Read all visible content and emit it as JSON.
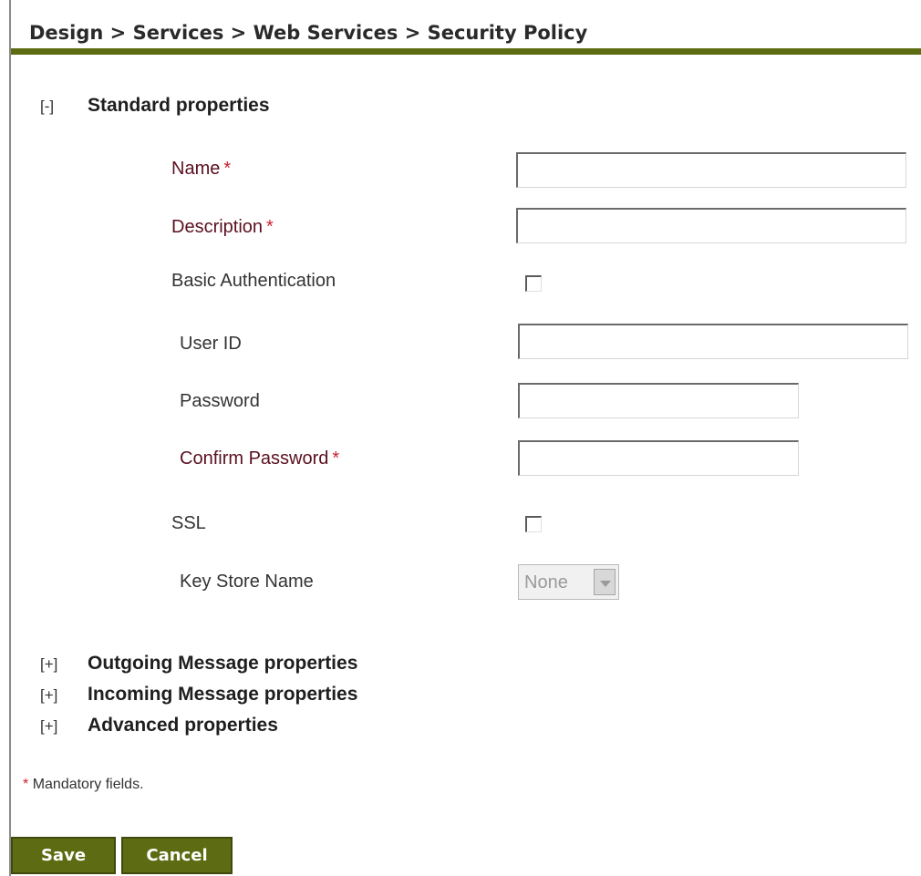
{
  "breadcrumb": "Design > Services > Web Services > Security Policy",
  "standard_section": {
    "toggle": "[-]",
    "title": "Standard properties"
  },
  "fields": {
    "name": {
      "label": "Name",
      "required": "*",
      "value": ""
    },
    "description": {
      "label": "Description",
      "required": "*",
      "value": ""
    },
    "basic_auth": {
      "label": "Basic Authentication",
      "checked": false
    },
    "user_id": {
      "label": "User ID",
      "value": ""
    },
    "password": {
      "label": "Password",
      "value": ""
    },
    "confirm_password": {
      "label": "Confirm Password",
      "required": "*",
      "value": ""
    },
    "ssl": {
      "label": "SSL",
      "checked": false
    },
    "key_store": {
      "label": "Key Store Name",
      "selected": "None"
    }
  },
  "collapsed_sections": [
    {
      "toggle": "[+]",
      "title": "Outgoing Message properties"
    },
    {
      "toggle": "[+]",
      "title": "Incoming Message properties"
    },
    {
      "toggle": "[+]",
      "title": "Advanced properties"
    }
  ],
  "footer": {
    "mandatory_star": "*",
    "mandatory_text": "Mandatory fields."
  },
  "buttons": {
    "save": "Save",
    "cancel": "Cancel"
  },
  "colors": {
    "accent": "#5d6b12",
    "required": "#cc1f2f"
  }
}
